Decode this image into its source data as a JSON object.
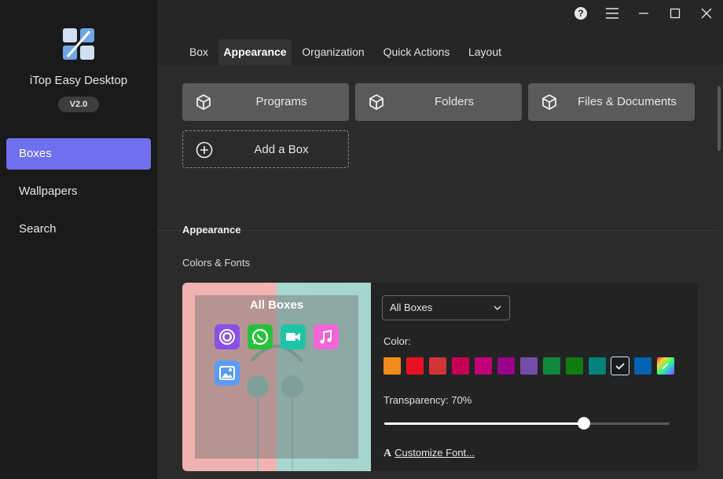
{
  "app": {
    "title": "iTop Easy Desktop",
    "version": "V2.0"
  },
  "sidebar": {
    "items": [
      {
        "label": "Boxes",
        "active": true
      },
      {
        "label": "Wallpapers",
        "active": false
      },
      {
        "label": "Search",
        "active": false
      }
    ]
  },
  "window_controls": {
    "help_icon": "help-circle-icon",
    "menu_icon": "hamburger-icon",
    "minimize_icon": "minimize-icon",
    "maximize_icon": "maximize-icon",
    "close_icon": "close-icon"
  },
  "tabs": [
    {
      "label": "Box",
      "active": false
    },
    {
      "label": "Appearance",
      "active": true
    },
    {
      "label": "Organization",
      "active": false
    },
    {
      "label": "Quick Actions",
      "active": false
    },
    {
      "label": "Layout",
      "active": false
    }
  ],
  "boxes": [
    {
      "label": "Programs",
      "icon": "cube-icon"
    },
    {
      "label": "Folders",
      "icon": "cube-icon"
    },
    {
      "label": "Files & Documents",
      "icon": "cube-icon"
    }
  ],
  "add_box": {
    "label": "Add a Box",
    "icon": "plus-circle-icon"
  },
  "appearance": {
    "section_title": "Appearance",
    "subsection_title": "Colors & Fonts",
    "preview": {
      "title": "All Boxes",
      "apps": [
        "chrome-icon",
        "whatsapp-icon",
        "facetime-icon",
        "music-icon",
        "photos-icon"
      ]
    },
    "box_select": {
      "value": "All Boxes"
    },
    "color_label": "Color:",
    "colors": [
      "#f08c1a",
      "#e81123",
      "#d13438",
      "#c30052",
      "#bf0077",
      "#9a0089",
      "#744da9",
      "#10893e",
      "#107c10",
      "#00827a",
      "#1a1a1a",
      "#0063b1",
      "custom"
    ],
    "selected_color_index": 10,
    "transparency_label": "Transparency: 70%",
    "transparency_value": 70,
    "font_link": "Customize Font..."
  }
}
